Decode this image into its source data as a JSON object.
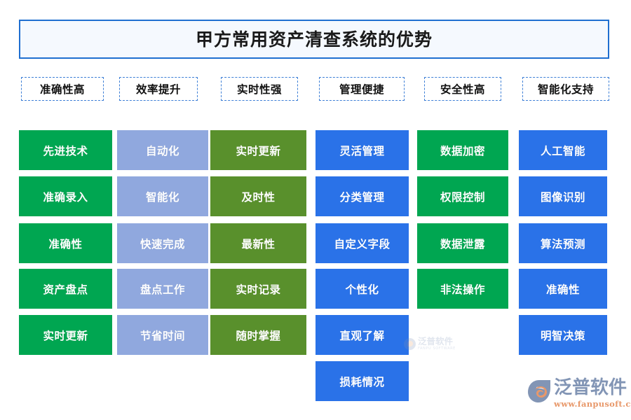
{
  "title": {
    "text": "甲方常用资产清查系统的优势"
  },
  "theme": {
    "title_border": "#1F6FD0",
    "title_bg": "#F5F9FE",
    "header_border": "#3D7FD6",
    "green": "#00A651",
    "periwinkle": "#90A8DE",
    "olive": "#59902C",
    "royal_blue": "#2A72E8"
  },
  "columns": [
    {
      "header": "准确性高",
      "color_key": "green",
      "color": "#00A651",
      "items": [
        "先进技术",
        "准确录入",
        "准确性",
        "资产盘点",
        "实时更新"
      ]
    },
    {
      "header": "效率提升",
      "color_key": "periwinkle",
      "color": "#90A8DE",
      "items": [
        "自动化",
        "智能化",
        "快速完成",
        "盘点工作",
        "节省时间"
      ]
    },
    {
      "header": "实时性强",
      "color_key": "olive",
      "color": "#59902C",
      "items": [
        "实时更新",
        "及时性",
        "最新性",
        "实时记录",
        "随时掌握"
      ]
    },
    {
      "header": "管理便捷",
      "color_key": "royal_blue",
      "color": "#2A72E8",
      "items": [
        "灵活管理",
        "分类管理",
        "自定义字段",
        "个性化",
        "直观了解",
        "损耗情况"
      ]
    },
    {
      "header": "安全性高",
      "color_key": "green",
      "color": "#00A651",
      "items": [
        "数据加密",
        "权限控制",
        "数据泄露",
        "非法操作"
      ]
    },
    {
      "header": "智能化支持",
      "color_key": "royal_blue",
      "color": "#2A72E8",
      "items": [
        "人工智能",
        "图像识别",
        "算法预测",
        "准确性",
        "明智决策"
      ]
    }
  ],
  "watermark": {
    "cn": "泛普软件",
    "en": "FANPU SOFTWARE"
  },
  "logo": {
    "cn": "泛普软件",
    "url": "www.fanpusoft.com"
  }
}
